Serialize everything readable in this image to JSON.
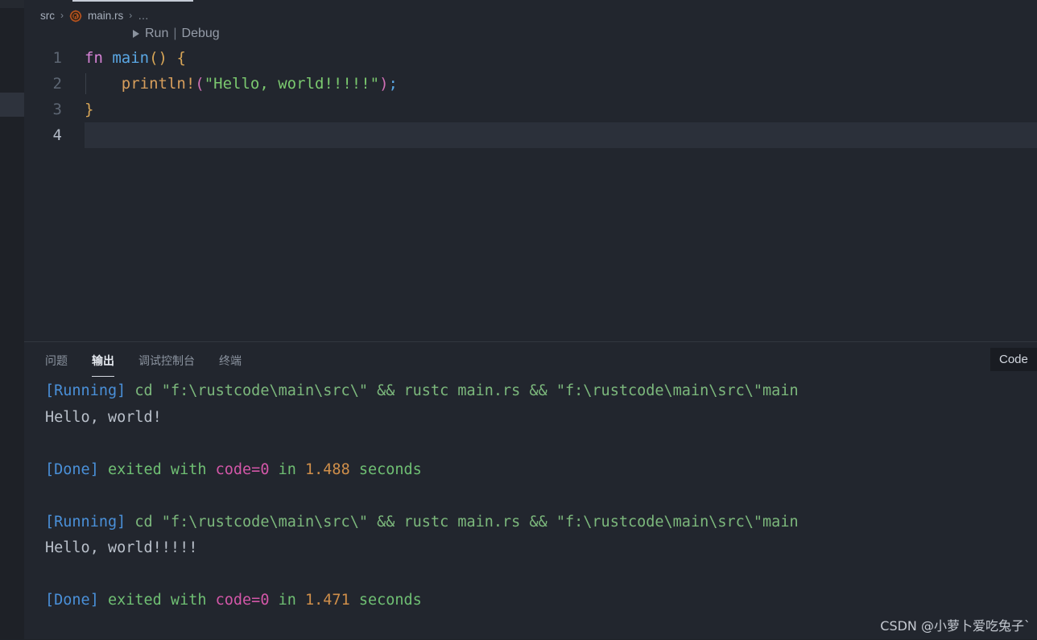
{
  "window": {
    "theme_bg": "#22262e",
    "accent": "#4a90d9"
  },
  "breadcrumb": {
    "items": [
      {
        "label": "src",
        "icon": ""
      },
      {
        "label": "main.rs",
        "icon": "rust-icon"
      },
      {
        "label": "…",
        "icon": ""
      }
    ],
    "separator": "›"
  },
  "codelens": {
    "run_label": "Run",
    "divider": "|",
    "debug_label": "Debug",
    "play_icon": "play-icon"
  },
  "editor": {
    "language": "rust",
    "filename": "main.rs",
    "active_line": 4,
    "lines": [
      {
        "number": "1",
        "tokens": [
          {
            "text": "fn",
            "cls": "t-kw"
          },
          {
            "text": " ",
            "cls": "t-plain"
          },
          {
            "text": "main",
            "cls": "t-fn"
          },
          {
            "text": "()",
            "cls": "t-punct"
          },
          {
            "text": " ",
            "cls": "t-plain"
          },
          {
            "text": "{",
            "cls": "t-punct"
          }
        ]
      },
      {
        "number": "2",
        "indent_guide": true,
        "tokens": [
          {
            "text": "    ",
            "cls": "t-plain"
          },
          {
            "text": "println!",
            "cls": "t-macro"
          },
          {
            "text": "(",
            "cls": "t-paren"
          },
          {
            "text": "\"Hello, world!!!!!\"",
            "cls": "t-str"
          },
          {
            "text": ")",
            "cls": "t-paren"
          },
          {
            "text": ";",
            "cls": "t-semi"
          }
        ]
      },
      {
        "number": "3",
        "tokens": [
          {
            "text": "}",
            "cls": "t-punct"
          }
        ]
      },
      {
        "number": "4",
        "tokens": []
      }
    ]
  },
  "panel": {
    "tabs": [
      {
        "label": "问题",
        "active": false,
        "name": "tab-problems"
      },
      {
        "label": "输出",
        "active": true,
        "name": "tab-output"
      },
      {
        "label": "调试控制台",
        "active": false,
        "name": "tab-debug-console"
      },
      {
        "label": "终端",
        "active": false,
        "name": "tab-terminal"
      }
    ],
    "channel_selected": "Code"
  },
  "output": {
    "lines": [
      {
        "type": "text",
        "segments": [
          {
            "text": "[Running]",
            "cls": "o-tag"
          },
          {
            "text": " cd \"f:\\rustcode\\main\\src\\\" && rustc main.rs && \"f:\\rustcode\\main\\src\\\"main",
            "cls": "o-cmd"
          }
        ]
      },
      {
        "type": "text",
        "segments": [
          {
            "text": "Hello, world!",
            "cls": "o-stdout"
          }
        ]
      },
      {
        "type": "blank",
        "segments": []
      },
      {
        "type": "text",
        "segments": [
          {
            "text": "[Done]",
            "cls": "o-tag"
          },
          {
            "text": " exited with ",
            "cls": "o-green"
          },
          {
            "text": "code=0",
            "cls": "o-code"
          },
          {
            "text": " in ",
            "cls": "o-green"
          },
          {
            "text": "1.488",
            "cls": "o-time"
          },
          {
            "text": " seconds",
            "cls": "o-green"
          }
        ]
      },
      {
        "type": "blank",
        "segments": []
      },
      {
        "type": "text",
        "segments": [
          {
            "text": "[Running]",
            "cls": "o-tag"
          },
          {
            "text": " cd \"f:\\rustcode\\main\\src\\\" && rustc main.rs && \"f:\\rustcode\\main\\src\\\"main",
            "cls": "o-cmd"
          }
        ]
      },
      {
        "type": "text",
        "segments": [
          {
            "text": "Hello, world!!!!!",
            "cls": "o-stdout"
          }
        ]
      },
      {
        "type": "blank",
        "segments": []
      },
      {
        "type": "text",
        "segments": [
          {
            "text": "[Done]",
            "cls": "o-tag"
          },
          {
            "text": " exited with ",
            "cls": "o-green"
          },
          {
            "text": "code=0",
            "cls": "o-code"
          },
          {
            "text": " in ",
            "cls": "o-green"
          },
          {
            "text": "1.471",
            "cls": "o-time"
          },
          {
            "text": " seconds",
            "cls": "o-green"
          }
        ]
      }
    ]
  },
  "watermark": {
    "text": "CSDN @小萝卜爱吃兔子`"
  }
}
